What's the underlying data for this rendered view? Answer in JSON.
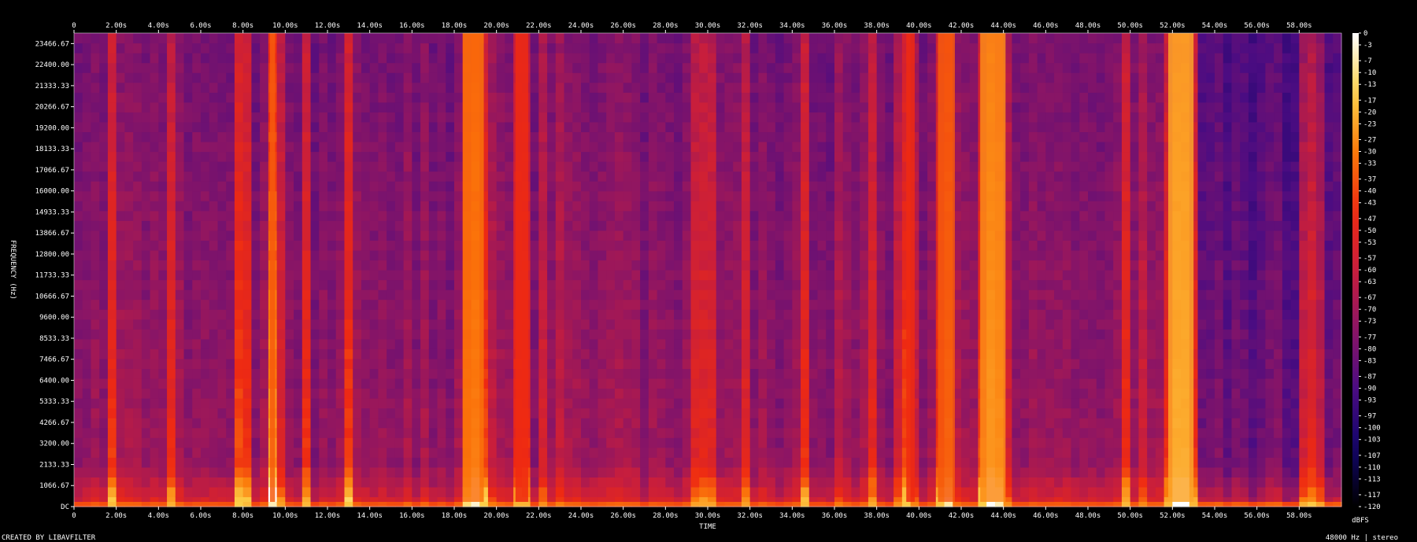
{
  "chart_data": {
    "type": "heatmap",
    "subtype": "spectrogram",
    "xlabel": "TIME",
    "ylabel": "FREQUENCY (Hz)",
    "colorbar_label": "dBFS",
    "x_ticks": [
      "0",
      "2.00s",
      "4.00s",
      "6.00s",
      "8.00s",
      "10.00s",
      "12.00s",
      "14.00s",
      "16.00s",
      "18.00s",
      "20.00s",
      "22.00s",
      "24.00s",
      "26.00s",
      "28.00s",
      "30.00s",
      "32.00s",
      "34.00s",
      "36.00s",
      "38.00s",
      "40.00s",
      "42.00s",
      "44.00s",
      "46.00s",
      "48.00s",
      "50.00s",
      "52.00s",
      "54.00s",
      "56.00s",
      "58.00s"
    ],
    "x_range_s": [
      0,
      60
    ],
    "y_ticks": [
      "DC",
      "1066.67",
      "2133.33",
      "3200.00",
      "4266.67",
      "5333.33",
      "6400.00",
      "7466.67",
      "8533.33",
      "9600.00",
      "10666.67",
      "11733.33",
      "12800.00",
      "13866.67",
      "14933.33",
      "16000.00",
      "17066.67",
      "18133.33",
      "19200.00",
      "20266.67",
      "21333.33",
      "22400.00",
      "23466.67"
    ],
    "y_range_hz": [
      0,
      24000
    ],
    "colorbar_ticks": [
      "0",
      "-3",
      "-7",
      "-10",
      "-13",
      "-17",
      "-20",
      "-23",
      "-27",
      "-30",
      "-33",
      "-37",
      "-40",
      "-43",
      "-47",
      "-50",
      "-53",
      "-57",
      "-60",
      "-63",
      "-67",
      "-70",
      "-73",
      "-77",
      "-80",
      "-83",
      "-87",
      "-90",
      "-93",
      "-97",
      "-100",
      "-103",
      "-107",
      "-110",
      "-113",
      "-117",
      "-120"
    ],
    "colorbar_range_dbfs": [
      -120,
      0
    ],
    "colormap": [
      "#000000",
      "#12056a",
      "#4b0c82",
      "#8b1565",
      "#c81e3c",
      "#ee2a12",
      "#fb7a0a",
      "#fdd24a",
      "#ffffff"
    ],
    "loud_time_bands_s": [
      {
        "t": 9.4,
        "w": 0.12,
        "level": 0.8
      },
      {
        "t": 18.9,
        "w": 0.5,
        "level": 0.85
      },
      {
        "t": 21.2,
        "w": 0.3,
        "level": 0.7
      },
      {
        "t": 39.6,
        "w": 0.2,
        "level": 0.7
      },
      {
        "t": 41.3,
        "w": 0.4,
        "level": 0.8
      },
      {
        "t": 43.5,
        "w": 0.6,
        "level": 0.9
      },
      {
        "t": 52.4,
        "w": 0.6,
        "level": 0.95
      }
    ],
    "footer_left": "CREATED BY LIBAVFILTER",
    "footer_right": "48000 Hz | stereo"
  }
}
